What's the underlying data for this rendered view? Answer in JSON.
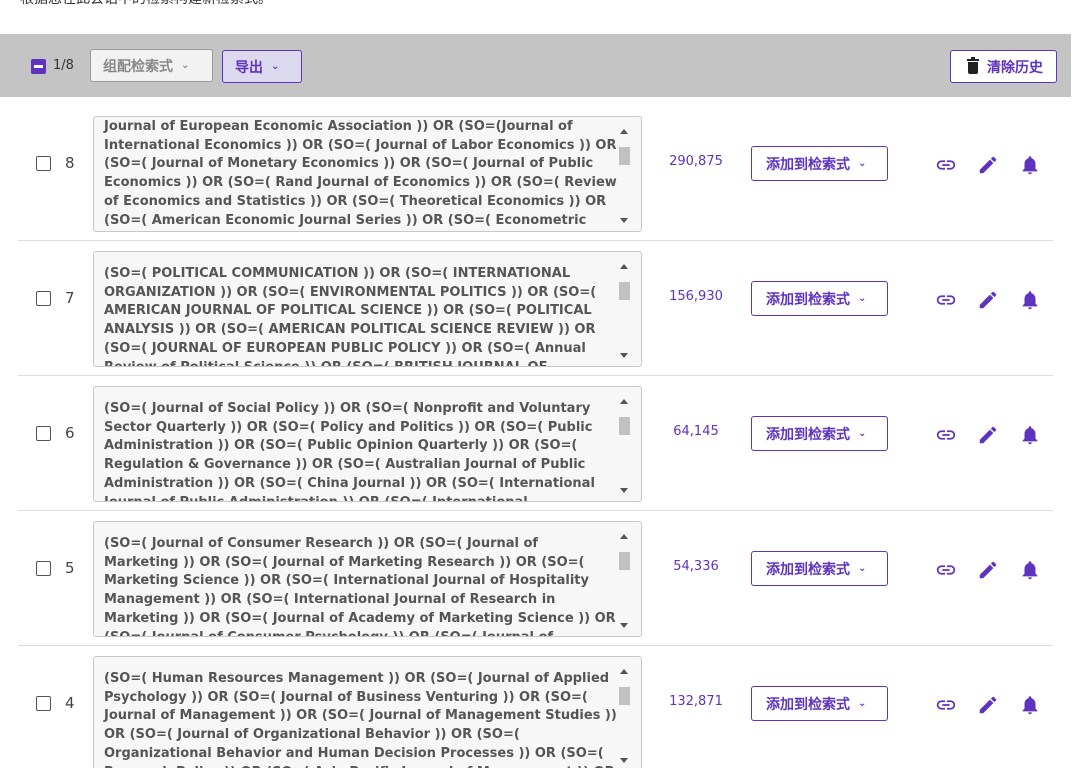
{
  "top_note": "根据您在此会话中的检索构建新检索式。",
  "toolbar": {
    "count": "1/8",
    "combine_label": "组配检索式",
    "export_label": "导出",
    "clear_history_label": "清除历史",
    "chevron": "⌄"
  },
  "colors": {
    "accent": "#5e33bf",
    "toolbar_bg": "#c4c4c4"
  },
  "icons": [
    "link-icon",
    "pencil-icon",
    "bell-icon",
    "trash-icon",
    "chevron-down-icon"
  ],
  "rows": [
    {
      "number": "8",
      "query": "Journal of European Economic Association )) OR (SO=(Journal of International Economics )) OR (SO=( Journal of Labor Economics )) OR (SO=( Journal of Monetary Economics )) OR (SO=( Journal of Public Economics )) OR (SO=( Rand Journal of Economics )) OR (SO=( Review of Economics and Statistics )) OR (SO=( Theoretical Economics )) OR (SO=( American Economic Journal Series )) OR (SO=( Econometric Theory )) OR (SO=( Economic Theory )) OR (SO=( International",
      "results": "290,875",
      "add_label": "添加到检索式"
    },
    {
      "number": "7",
      "query": "(SO=( POLITICAL COMMUNICATION )) OR (SO=( INTERNATIONAL ORGANIZATION )) OR (SO=( ENVIRONMENTAL POLITICS )) OR (SO=( AMERICAN JOURNAL OF POLITICAL SCIENCE )) OR (SO=( POLITICAL ANALYSIS )) OR (SO=( AMERICAN POLITICAL SCIENCE REVIEW )) OR (SO=( JOURNAL OF EUROPEAN PUBLIC POLICY )) OR (SO=( Annual Review of Political Science )) OR (SO=( BRITISH JOURNAL OF",
      "results": "156,930",
      "add_label": "添加到检索式"
    },
    {
      "number": "6",
      "query": "(SO=( Journal of Social Policy )) OR (SO=( Nonprofit and Voluntary Sector Quarterly )) OR (SO=( Policy and Politics )) OR (SO=( Public Administration )) OR (SO=( Public Opinion Quarterly )) OR (SO=( Regulation & Governance )) OR (SO=( Australian Journal of Public Administration )) OR (SO=( China Journal )) OR (SO=( International Journal of Public Administration )) OR (SO=( International",
      "results": "64,145",
      "add_label": "添加到检索式"
    },
    {
      "number": "5",
      "query": "(SO=( Journal of Consumer Research )) OR (SO=( Journal of Marketing )) OR (SO=( Journal of Marketing Research )) OR (SO=( Marketing Science )) OR (SO=( International Journal of Hospitality Management )) OR (SO=( International Journal of Research in Marketing )) OR (SO=( Journal of Academy of Marketing Science )) OR (SO=( Journal of Consumer Psychology )) OR (SO=( Journal of",
      "results": "54,336",
      "add_label": "添加到检索式"
    },
    {
      "number": "4",
      "query": "(SO=( Human Resources Management )) OR (SO=( Journal of Applied Psychology )) OR (SO=( Journal of Business Venturing )) OR (SO=( Journal of Management )) OR (SO=( Journal of Management Studies )) OR (SO=( Journal of Organizational Behavior )) OR (SO=( Organizational Behavior and Human Decision Processes )) OR (SO=( Research Policy )) OR (SO=( Asia Pacific Journal of Management )) OR",
      "results": "132,871",
      "add_label": "添加到检索式"
    }
  ]
}
